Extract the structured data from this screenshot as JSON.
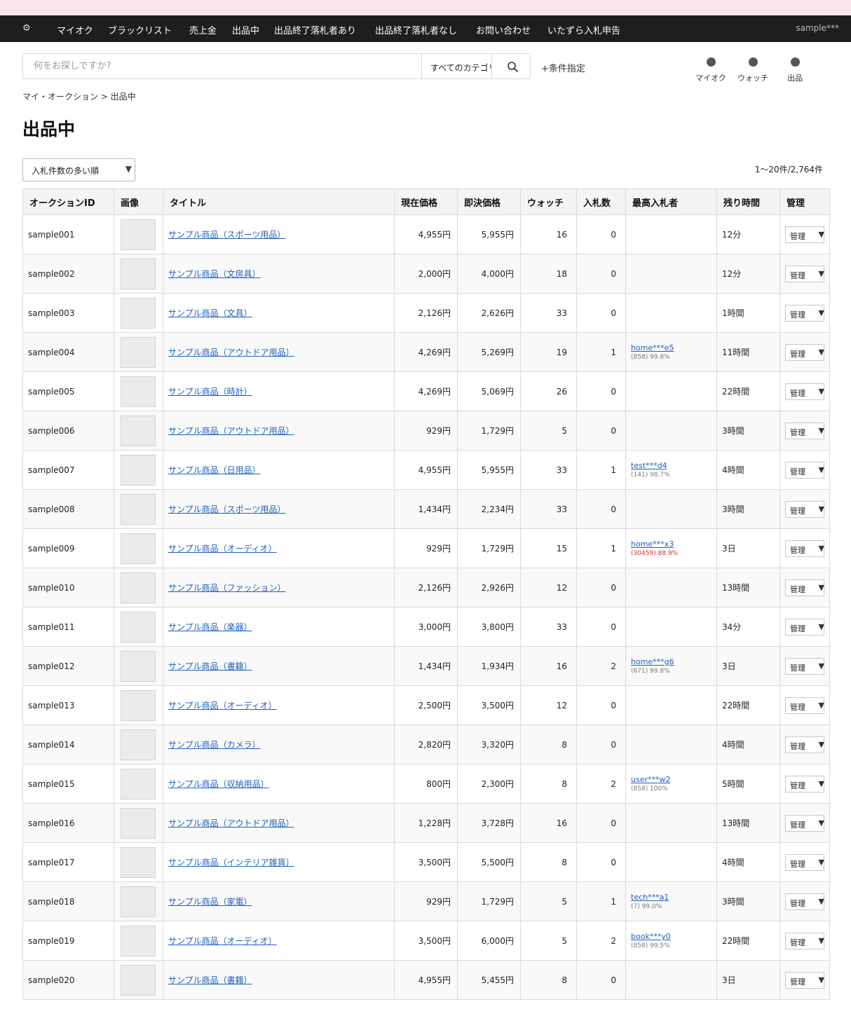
{
  "nav": {
    "gear": "⚙",
    "items": [
      "マイオク",
      "ブラックリスト",
      "売上金",
      "出品中",
      "出品終了落札者あり",
      "出品終了落札者なし",
      "お問い合わせ",
      "いたずら入札申告"
    ],
    "user": "sample***"
  },
  "search": {
    "placeholder": "何をお探しですか?",
    "category": "すべてのカテゴリ",
    "condition_link": "+条件指定"
  },
  "quick_links": [
    "マイオク",
    "ウォッチ",
    "出品"
  ],
  "breadcrumb": "マイ・オークション > 出品中",
  "page_title": "出品中",
  "sort": {
    "selected": "入札件数の多い順",
    "arrow": "▼"
  },
  "count_text": "1〜20件/2,764件",
  "table": {
    "headers": [
      "オークションID",
      "画像",
      "タイトル",
      "現在価格",
      "即決価格",
      "ウォッチ",
      "入札数",
      "最高入札者",
      "残り時間",
      "管理"
    ],
    "manage_label": "管理",
    "manage_arrow": "▼",
    "rows": [
      {
        "id": "sample001",
        "title": "サンプル商品（スポーツ用品）",
        "price": "4,955円",
        "buyout": "5,955円",
        "watch": "16",
        "bids": "0",
        "bidder": "",
        "rating": "",
        "time": "12分"
      },
      {
        "id": "sample002",
        "title": "サンプル商品（文房具）",
        "price": "2,000円",
        "buyout": "4,000円",
        "watch": "18",
        "bids": "0",
        "bidder": "",
        "rating": "",
        "time": "12分"
      },
      {
        "id": "sample003",
        "title": "サンプル商品（文具）",
        "price": "2,126円",
        "buyout": "2,626円",
        "watch": "33",
        "bids": "0",
        "bidder": "",
        "rating": "",
        "time": "1時間"
      },
      {
        "id": "sample004",
        "title": "サンプル商品（アウトドア用品）",
        "price": "4,269円",
        "buyout": "5,269円",
        "watch": "19",
        "bids": "1",
        "bidder": "home***e5",
        "rating": "(858) 99.8%",
        "time": "11時間"
      },
      {
        "id": "sample005",
        "title": "サンプル商品（時計）",
        "price": "4,269円",
        "buyout": "5,069円",
        "watch": "26",
        "bids": "0",
        "bidder": "",
        "rating": "",
        "time": "22時間"
      },
      {
        "id": "sample006",
        "title": "サンプル商品（アウトドア用品）",
        "price": "929円",
        "buyout": "1,729円",
        "watch": "5",
        "bids": "0",
        "bidder": "",
        "rating": "",
        "time": "3時間"
      },
      {
        "id": "sample007",
        "title": "サンプル商品（日用品）",
        "price": "4,955円",
        "buyout": "5,955円",
        "watch": "33",
        "bids": "1",
        "bidder": "test***d4",
        "rating": "(141) 98.7%",
        "time": "4時間"
      },
      {
        "id": "sample008",
        "title": "サンプル商品（スポーツ用品）",
        "price": "1,434円",
        "buyout": "2,234円",
        "watch": "33",
        "bids": "0",
        "bidder": "",
        "rating": "",
        "time": "3時間"
      },
      {
        "id": "sample009",
        "title": "サンプル商品（オーディオ）",
        "price": "929円",
        "buyout": "1,729円",
        "watch": "15",
        "bids": "1",
        "bidder": "home***x3",
        "rating": "(30459) 88.9%",
        "rating_low": true,
        "time": "3日"
      },
      {
        "id": "sample010",
        "title": "サンプル商品（ファッション）",
        "price": "2,126円",
        "buyout": "2,926円",
        "watch": "12",
        "bids": "0",
        "bidder": "",
        "rating": "",
        "time": "13時間"
      },
      {
        "id": "sample011",
        "title": "サンプル商品（楽器）",
        "price": "3,000円",
        "buyout": "3,800円",
        "watch": "33",
        "bids": "0",
        "bidder": "",
        "rating": "",
        "time": "34分"
      },
      {
        "id": "sample012",
        "title": "サンプル商品（書籍）",
        "price": "1,434円",
        "buyout": "1,934円",
        "watch": "16",
        "bids": "2",
        "bidder": "home***g6",
        "rating": "(671) 99.8%",
        "time": "3日"
      },
      {
        "id": "sample013",
        "title": "サンプル商品（オーディオ）",
        "price": "2,500円",
        "buyout": "3,500円",
        "watch": "12",
        "bids": "0",
        "bidder": "",
        "rating": "",
        "time": "22時間"
      },
      {
        "id": "sample014",
        "title": "サンプル商品（カメラ）",
        "price": "2,820円",
        "buyout": "3,320円",
        "watch": "8",
        "bids": "0",
        "bidder": "",
        "rating": "",
        "time": "4時間"
      },
      {
        "id": "sample015",
        "title": "サンプル商品（収納用品）",
        "price": "800円",
        "buyout": "2,300円",
        "watch": "8",
        "bids": "2",
        "bidder": "user***w2",
        "rating": "(858) 100%",
        "time": "5時間"
      },
      {
        "id": "sample016",
        "title": "サンプル商品（アウトドア用品）",
        "price": "1,228円",
        "buyout": "3,728円",
        "watch": "16",
        "bids": "0",
        "bidder": "",
        "rating": "",
        "time": "13時間"
      },
      {
        "id": "sample017",
        "title": "サンプル商品（インテリア雑貨）",
        "price": "3,500円",
        "buyout": "5,500円",
        "watch": "8",
        "bids": "0",
        "bidder": "",
        "rating": "",
        "time": "4時間"
      },
      {
        "id": "sample018",
        "title": "サンプル商品（家電）",
        "price": "929円",
        "buyout": "1,729円",
        "watch": "5",
        "bids": "1",
        "bidder": "tech***a1",
        "rating": "(7) 99.0%",
        "time": "3時間"
      },
      {
        "id": "sample019",
        "title": "サンプル商品（オーディオ）",
        "price": "3,500円",
        "buyout": "6,000円",
        "watch": "5",
        "bids": "2",
        "bidder": "book***y0",
        "rating": "(858) 99.5%",
        "time": "22時間"
      },
      {
        "id": "sample020",
        "title": "サンプル商品（書籍）",
        "price": "4,955円",
        "buyout": "5,455円",
        "watch": "8",
        "bids": "0",
        "bidder": "",
        "rating": "",
        "time": "3日"
      }
    ]
  }
}
